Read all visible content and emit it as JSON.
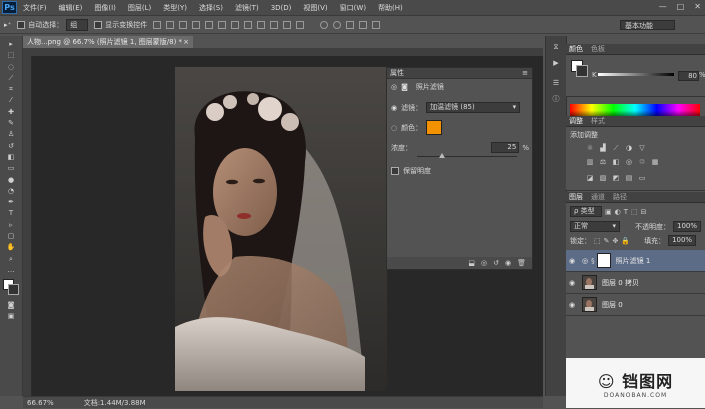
{
  "app": {
    "logo": "Ps"
  },
  "menu": [
    "文件(F)",
    "编辑(E)",
    "图像(I)",
    "图层(L)",
    "类型(Y)",
    "选择(S)",
    "滤镜(T)",
    "3D(D)",
    "视图(V)",
    "窗口(W)",
    "帮助(H)"
  ],
  "window_controls": [
    "—",
    "□",
    "✕"
  ],
  "options": {
    "auto_select_label": "自动选择：",
    "auto_select_value": "组",
    "show_transform_label": "显示变换控件",
    "workspace": "基本功能"
  },
  "document": {
    "tab_title": "人物...png @ 66.7% (照片滤镜 1, 图层蒙版/8) *",
    "zoom": "66.67%",
    "doc_size": "文档:1.44M/3.88M"
  },
  "properties": {
    "panel_title": "属性",
    "adjustment_name": "照片滤镜",
    "filter_label": "滤镜：",
    "filter_value": "加温滤镜 (85)",
    "color_label": "颜色：",
    "density_label": "浓度：",
    "density_value": "25",
    "density_unit": "%",
    "density_fraction": 0.25,
    "preserve_label": "保留明度",
    "swatch_color": "#f39200"
  },
  "color_panel": {
    "tabs": [
      "颜色",
      "色板"
    ],
    "k_label": "K",
    "k_value": "80",
    "k_unit": "%"
  },
  "adjustments_panel": {
    "tabs": [
      "调整",
      "样式"
    ],
    "hint": "添加调整"
  },
  "layers_panel": {
    "tabs": [
      "图层",
      "通道",
      "路径"
    ],
    "kind_value": "ρ 类型",
    "blend_mode": "正常",
    "opacity_label": "不透明度：",
    "opacity_value": "100%",
    "lock_label": "锁定：",
    "fill_label": "填充：",
    "fill_value": "100%",
    "layers": [
      {
        "name": "照片滤镜 1",
        "type": "adjustment",
        "selected": true
      },
      {
        "name": "图层 0 拷贝",
        "type": "pixel",
        "selected": false
      },
      {
        "name": "图层 0",
        "type": "pixel",
        "selected": false
      }
    ]
  },
  "watermark": {
    "logo": "☺ 铛图网",
    "sub": "DOANOBAN.COM"
  }
}
